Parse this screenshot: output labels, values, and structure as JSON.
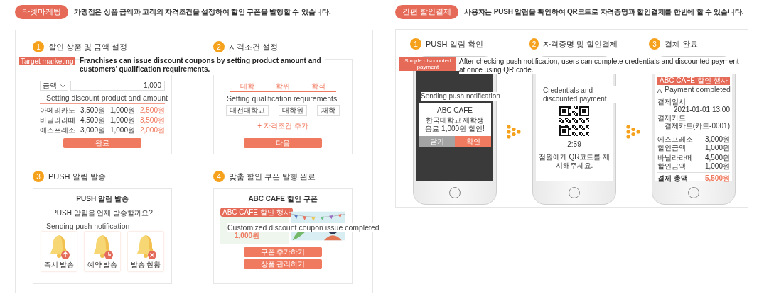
{
  "left": {
    "tag": "타겟마케팅",
    "description": "가맹점은 상품 금액과 고객의 자격조건을 설정하여 할인 쿠폰을 발행할 수 있습니다.",
    "overlay_tag": "Target marketing",
    "overlay_description": "Franchises can issue discount coupons by setting product amount and customers’ qualification requirements.",
    "steps": [
      {
        "number": "1",
        "title": "할인 상품 및 금액 설정",
        "kind": "amount",
        "caption": "Setting discount product and amount",
        "select": "금액",
        "amount": "1,000",
        "rows": [
          [
            "아메리카노",
            "3,500원",
            "1,000원",
            "2,500원"
          ],
          [
            "바닐라라떼",
            "4,500원",
            "1,000원",
            "3,500원"
          ],
          [
            "에스프레소",
            "3,000원",
            "1,000원",
            "2,000원"
          ]
        ],
        "button": "완료"
      },
      {
        "number": "2",
        "title": "자격조건 설정",
        "kind": "qualification",
        "caption": "Setting qualification requirements",
        "tabs": [
          "대학",
          "학위",
          "학적"
        ],
        "chips": [
          "대전대학교",
          "대학원",
          "재학"
        ],
        "add_link": "+ 자격조건 추가",
        "button": "다음"
      },
      {
        "number": "3",
        "title": "PUSH 알림 발송",
        "kind": "push",
        "heading": "PUSH 알림 발송",
        "question": "PUSH 알림을 언제 발송할까요?",
        "caption": "Sending push notification",
        "options": [
          {
            "label": "즉시 발송",
            "kind": "send"
          },
          {
            "label": "예약 발송",
            "kind": "schedule"
          },
          {
            "label": "발송 현황",
            "kind": "cancel"
          }
        ]
      },
      {
        "number": "4",
        "title": "맞춤 할인 쿠폰 발행 완료",
        "kind": "coupon",
        "heading": "ABC CAFE 할인 쿠폰",
        "banner_tag": "ABC CAFE 할인 행사",
        "coupon_amount": "1,000원",
        "caption": "Customized discount coupon issue completed",
        "buttons": [
          "쿠폰 추가하기",
          "상품 관리하기"
        ]
      }
    ]
  },
  "right": {
    "tag": "간편 할인결제",
    "description": "사용자는 PUSH 알림을 확인하여 QR코드로 자격증명과 할인결제를 한번에 할 수 있습니다.",
    "overlay_tag": "Simple discounted payment",
    "overlay_description": "After checking push notification, users can complete credentials and discounted payment at once using QR code.",
    "steps": [
      {
        "number": "1",
        "title": "PUSH 알림 확인",
        "kind": "push",
        "caption": "Sending push notification",
        "popup_title": "ABC CAFE",
        "popup_lines": [
          "한국대학교 재학생",
          "음료 1,000원 할인!"
        ],
        "buttons": [
          {
            "label": "닫기",
            "kind": "secondary"
          },
          {
            "label": "확인",
            "kind": "primary"
          }
        ]
      },
      {
        "number": "2",
        "title": "자격증명 및 할인결제",
        "kind": "qr",
        "caption": "Credentials and discounted payment",
        "timer": "2:59",
        "note": "점원에게 QR코드를 제시해주세요."
      },
      {
        "number": "3",
        "title": "결제 완료",
        "kind": "receipt",
        "tag": "ABC CAFE 할인 행사",
        "heading_fragment": "A",
        "caption": "Payment completed",
        "info": [
          [
            "결제일시",
            "2021-01-01 13:00"
          ],
          [
            "결제카드",
            "결제카드(카드-0001)"
          ]
        ],
        "items": [
          [
            "에스프레소",
            "3,000원"
          ],
          [
            "할인금액",
            "1,000원"
          ],
          [
            "바닐라라떼",
            "4,500원"
          ],
          [
            "할인금액",
            "1,000원"
          ]
        ],
        "total": [
          "결제 총액",
          "5,500원"
        ]
      }
    ]
  }
}
